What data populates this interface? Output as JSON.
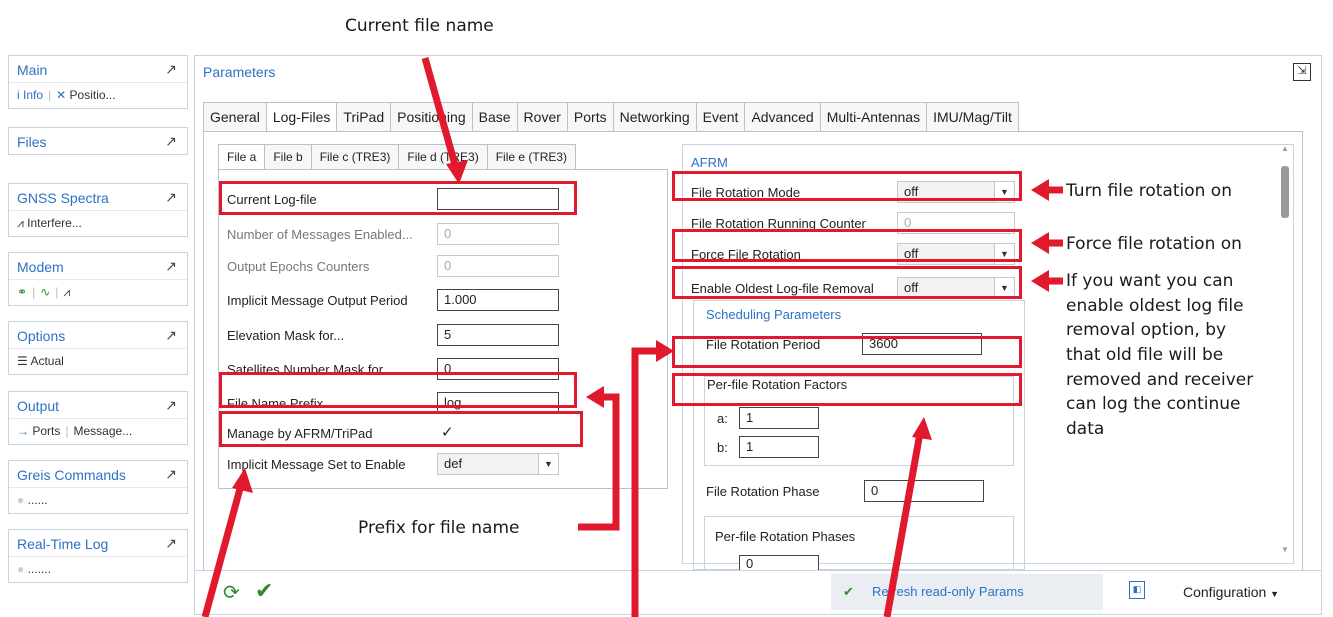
{
  "annotations": {
    "current_file_name": "Current file name",
    "turn_rotation_on": "Turn file rotation on",
    "force_rotation_on": "Force file rotation on",
    "oldest_removal": [
      "If you want  you can",
      "enable oldest log file",
      "removal option, by",
      "that old file will be",
      "removed and receiver",
      "can log the continue",
      "data"
    ],
    "prefix_for_file_name": "Prefix for file name"
  },
  "sidebar": {
    "main": {
      "title": "Main",
      "items": [
        "i Info",
        "Positio..."
      ]
    },
    "files": {
      "title": "Files"
    },
    "gnss": {
      "title": "GNSS Spectra",
      "items": [
        "Interfere..."
      ]
    },
    "modem": {
      "title": "Modem"
    },
    "options": {
      "title": "Options",
      "items": [
        "Actual"
      ]
    },
    "output": {
      "title": "Output",
      "items": [
        "Ports",
        "Message..."
      ]
    },
    "greis": {
      "title": "Greis Commands",
      "items": [
        "......"
      ]
    },
    "rtlog": {
      "title": "Real-Time Log",
      "items": [
        "......."
      ]
    }
  },
  "main": {
    "title": "Parameters",
    "tabs": [
      "General",
      "Log-Files",
      "TriPad",
      "Positioning",
      "Base",
      "Rover",
      "Ports",
      "Networking",
      "Event",
      "Advanced",
      "Multi-Antennas",
      "IMU/Mag/Tilt"
    ],
    "active_tab": "Log-Files"
  },
  "file_tabs": [
    "File a",
    "File b",
    "File c (TRE3)",
    "File d (TRE3)",
    "File e (TRE3)"
  ],
  "log": {
    "current_log_file": {
      "label": "Current Log-file",
      "value": ""
    },
    "num_messages": {
      "label": "Number of Messages Enabled...",
      "value": "0"
    },
    "epochs": {
      "label": "Output Epochs Counters",
      "value": "0"
    },
    "implicit_period": {
      "label": "Implicit Message Output Period",
      "value": "1.000"
    },
    "elevation": {
      "label": "Elevation Mask for...",
      "value": "5"
    },
    "satellites": {
      "label": "Satellites Number Mask for...",
      "value": "0"
    },
    "prefix": {
      "label": "File Name Prefix",
      "value": "log"
    },
    "manage": {
      "label": "Manage by AFRM/TriPad",
      "value": "✓"
    },
    "implicit_set": {
      "label": "Implicit Message Set to Enable",
      "value": "def"
    }
  },
  "afrm": {
    "title": "AFRM",
    "rotation_mode": {
      "label": "File Rotation Mode",
      "value": "off"
    },
    "running_counter": {
      "label": "File Rotation Running Counter",
      "value": "0"
    },
    "force_rotation": {
      "label": "Force File Rotation",
      "value": "off"
    },
    "oldest_removal": {
      "label": "Enable Oldest Log-file Removal",
      "value": "off"
    },
    "scheduling": {
      "title": "Scheduling Parameters",
      "period": {
        "label": "File Rotation Period",
        "value": "3600"
      },
      "factors_title": "Per-file Rotation Factors",
      "a": {
        "label": "a:",
        "value": "1"
      },
      "b": {
        "label": "b:",
        "value": "1"
      },
      "phase": {
        "label": "File Rotation Phase",
        "value": "0"
      },
      "phases_title": "Per-file Rotation Phases",
      "phases_first": "0"
    }
  },
  "footer": {
    "refresh": "Refresh read-only Params",
    "configuration": "Configuration"
  },
  "colors": {
    "accent": "#2d72c4",
    "highlight": "#e0192d",
    "ok": "#2e8b2e"
  }
}
